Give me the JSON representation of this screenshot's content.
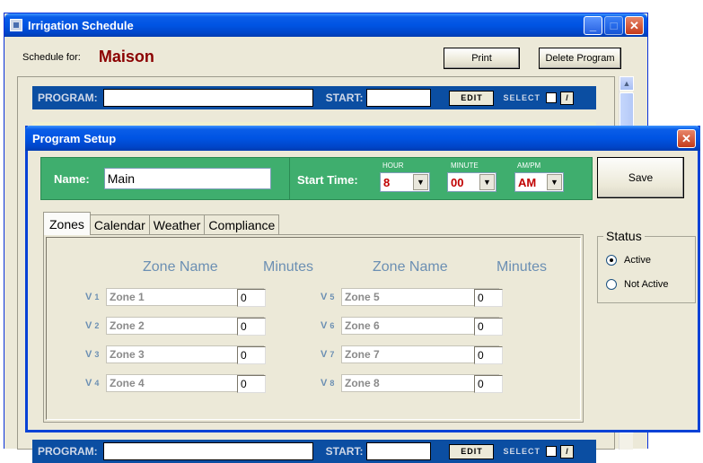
{
  "main_window": {
    "title": "Irrigation Schedule",
    "schedule_label": "Schedule for:",
    "schedule_name": "Maison",
    "print_label": "Print",
    "delete_label": "Delete Program",
    "program_bar": {
      "program_label": "PROGRAM:",
      "start_label": "START:",
      "edit_label": "EDIT",
      "select_label": "SELECT",
      "slash_glyph": "/"
    },
    "scroll_up_glyph": "▲"
  },
  "dialog": {
    "title": "Program Setup",
    "name_label": "Name:",
    "name_value": "Main",
    "start_time_label": "Start Time:",
    "hour_caption": "HOUR",
    "hour_value": "8",
    "minute_caption": "MINUTE",
    "minute_value": "00",
    "ampm_caption": "AM/PM",
    "ampm_value": "AM",
    "save_label": "Save",
    "tabs": [
      {
        "label": "Zones",
        "active": true
      },
      {
        "label": "Calendar",
        "active": false
      },
      {
        "label": "Weather",
        "active": false
      },
      {
        "label": "Compliance",
        "active": false
      }
    ],
    "zone_name_header": "Zone Name",
    "minutes_header": "Minutes",
    "zones": [
      {
        "tag": "V",
        "num": "1",
        "name": "Zone 1",
        "minutes": "0"
      },
      {
        "tag": "V",
        "num": "2",
        "name": "Zone 2",
        "minutes": "0"
      },
      {
        "tag": "V",
        "num": "3",
        "name": "Zone 3",
        "minutes": "0"
      },
      {
        "tag": "V",
        "num": "4",
        "name": "Zone 4",
        "minutes": "0"
      },
      {
        "tag": "V",
        "num": "5",
        "name": "Zone 5",
        "minutes": "0"
      },
      {
        "tag": "V",
        "num": "6",
        "name": "Zone 6",
        "minutes": "0"
      },
      {
        "tag": "V",
        "num": "7",
        "name": "Zone 7",
        "minutes": "0"
      },
      {
        "tag": "V",
        "num": "8",
        "name": "Zone 8",
        "minutes": "0"
      }
    ],
    "status": {
      "title": "Status",
      "options": [
        {
          "label": "Active",
          "selected": true
        },
        {
          "label": "Not Active",
          "selected": false
        }
      ]
    }
  },
  "window_controls": {
    "minimize": "_",
    "maximize": "□",
    "close": "✕",
    "dropdown": "▼"
  },
  "colors": {
    "title_bar": "#0054e3",
    "green_panel": "#3fae6e",
    "program_bar": "#0b4ea2",
    "zone_label": "#6b8fb3",
    "schedule_name": "#8b0000",
    "select_value": "#c00000"
  }
}
